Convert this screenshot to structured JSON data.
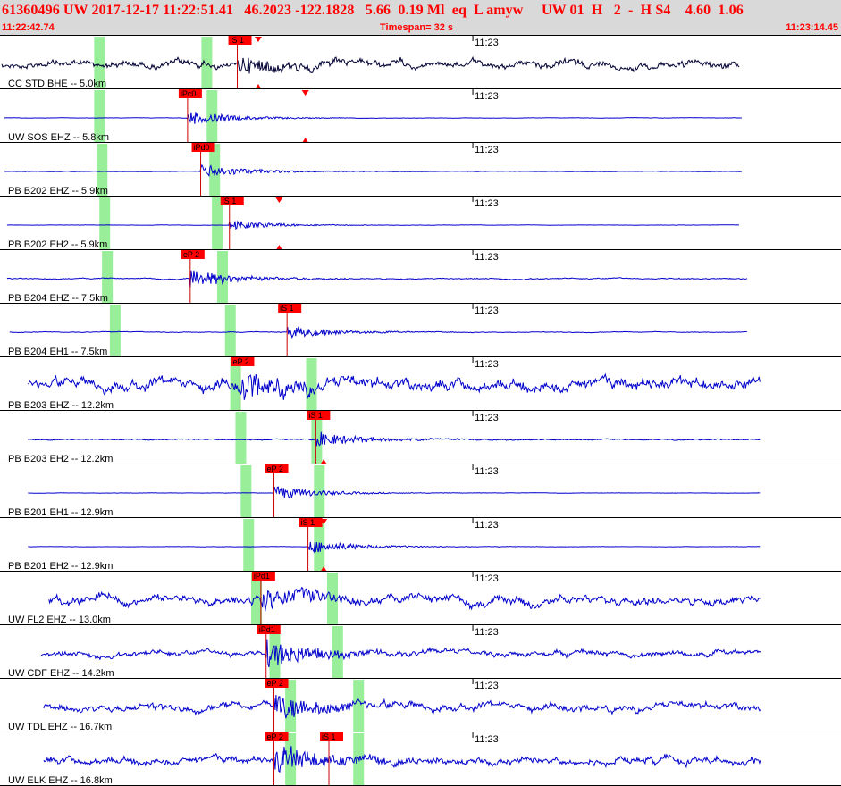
{
  "header": {
    "title": "61360496 UW 2017-12-17 11:22:51.41   46.2023 -122.1828   5.66  0.19 Ml  eq  L amyw     UW 01  H   2  -  H S4    4.60  1.06",
    "start_time": "11:22:42.74",
    "timespan": "Timespan=  32 s",
    "end_time": "11:23:14.45"
  },
  "colors": {
    "trace_first": "#000033",
    "trace": "#0000cc",
    "pick_box": "#ff0000",
    "pick_line": "#cc0000",
    "window": "#99ee99",
    "separator": "#000000"
  },
  "tick_label": "11:23",
  "channels": [
    {
      "label": "CC STD BHE -- 5.0km",
      "picks": [
        {
          "text": "iS 1",
          "t": 9.0
        }
      ],
      "marks": [
        9.8
      ],
      "windows": [
        3.7,
        7.8
      ],
      "amp": 7,
      "noise": 0.85,
      "burst": 0.6,
      "start": 0.0,
      "end": 28.2
    },
    {
      "label": "UW SOS EHZ -- 5.8km",
      "picks": [
        {
          "text": "iPc0",
          "t": 7.1
        }
      ],
      "marks": [
        11.6
      ],
      "windows": [
        3.7,
        8.0
      ],
      "amp": 4,
      "noise": 0.08,
      "burst": 1.0,
      "start": 0.1,
      "end": 28.3
    },
    {
      "label": "PB B202 EHZ -- 5.9km",
      "picks": [
        {
          "text": "iPd0",
          "t": 7.6
        }
      ],
      "marks": [],
      "windows": [
        3.8,
        8.1
      ],
      "amp": 4,
      "noise": 0.08,
      "burst": 1.0,
      "start": 0.1,
      "end": 28.3
    },
    {
      "label": "PB B202 EH2 -- 5.9km",
      "picks": [
        {
          "text": "iS 1",
          "t": 8.7
        }
      ],
      "marks": [
        10.6
      ],
      "windows": [
        3.9,
        8.2
      ],
      "amp": 3,
      "noise": 0.08,
      "burst": 0.9,
      "start": 0.2,
      "end": 28.2
    },
    {
      "label": "PB B204 EHZ -- 7.5km",
      "picks": [
        {
          "text": "eP 2",
          "t": 7.2
        }
      ],
      "marks": [],
      "windows": [
        4.0,
        8.4
      ],
      "amp": 5,
      "noise": 0.2,
      "burst": 1.0,
      "start": 0.2,
      "end": 28.5
    },
    {
      "label": "PB B204 EH1 -- 7.5km",
      "picks": [
        {
          "text": "iS 1",
          "t": 10.9
        }
      ],
      "marks": [],
      "windows": [
        4.3,
        8.7
      ],
      "amp": 4,
      "noise": 0.15,
      "burst": 0.9,
      "start": 0.3,
      "end": 28.5
    },
    {
      "label": "PB B203 EHZ -- 12.2km",
      "picks": [
        {
          "text": "eP 2",
          "t": 9.1
        }
      ],
      "marks": [],
      "windows": [
        8.9,
        11.8
      ],
      "amp": 11,
      "noise": 0.9,
      "burst": 0.6,
      "start": 1.0,
      "end": 29.0
    },
    {
      "label": "PB B203 EH2 -- 12.2km",
      "picks": [
        {
          "text": "iS 1",
          "t": 12.0
        }
      ],
      "marks": [
        12.3
      ],
      "windows": [
        9.1,
        12.0
      ],
      "amp": 4,
      "noise": 0.25,
      "burst": 1.0,
      "start": 1.0,
      "end": 29.0
    },
    {
      "label": "PB B201 EH1 -- 12.9km",
      "picks": [
        {
          "text": "eP 2",
          "t": 10.4
        }
      ],
      "marks": [],
      "windows": [
        9.3,
        12.1
      ],
      "amp": 4,
      "noise": 0.06,
      "burst": 1.0,
      "start": 1.0,
      "end": 29.0
    },
    {
      "label": "PB B201 EH2 -- 12.9km",
      "picks": [
        {
          "text": "iS 1",
          "t": 11.7
        }
      ],
      "marks": [
        12.3
      ],
      "windows": [
        9.4,
        12.1
      ],
      "amp": 4,
      "noise": 0.06,
      "burst": 1.0,
      "start": 1.0,
      "end": 29.0
    },
    {
      "label": "UW FL2 EHZ -- 13.0km",
      "picks": [
        {
          "text": "iPd1",
          "t": 9.9
        }
      ],
      "marks": [],
      "windows": [
        9.7,
        12.6
      ],
      "amp": 9,
      "noise": 0.85,
      "burst": 0.6,
      "start": 1.8,
      "end": 29.0
    },
    {
      "label": "UW CDF EHZ -- 14.2km",
      "picks": [
        {
          "text": "iPd1",
          "t": 10.1
        }
      ],
      "marks": [],
      "windows": [
        10.4,
        12.8
      ],
      "amp": 9,
      "noise": 0.5,
      "burst": 0.8,
      "start": 1.5,
      "end": 29.0
    },
    {
      "label": "UW TDL EHZ -- 16.7km",
      "picks": [
        {
          "text": "eP 2",
          "t": 10.4
        }
      ],
      "marks": [],
      "windows": [
        11.0,
        13.6
      ],
      "amp": 9,
      "noise": 0.7,
      "burst": 0.8,
      "start": 1.6,
      "end": 29.0
    },
    {
      "label": "UW ELK EHZ -- 16.8km",
      "picks": [
        {
          "text": "eP 2",
          "t": 10.4
        },
        {
          "text": "iS 1",
          "t": 12.5
        }
      ],
      "marks": [],
      "windows": [
        11.0,
        13.6
      ],
      "amp": 9,
      "noise": 0.7,
      "burst": 0.8,
      "start": 1.6,
      "end": 29.0
    }
  ]
}
